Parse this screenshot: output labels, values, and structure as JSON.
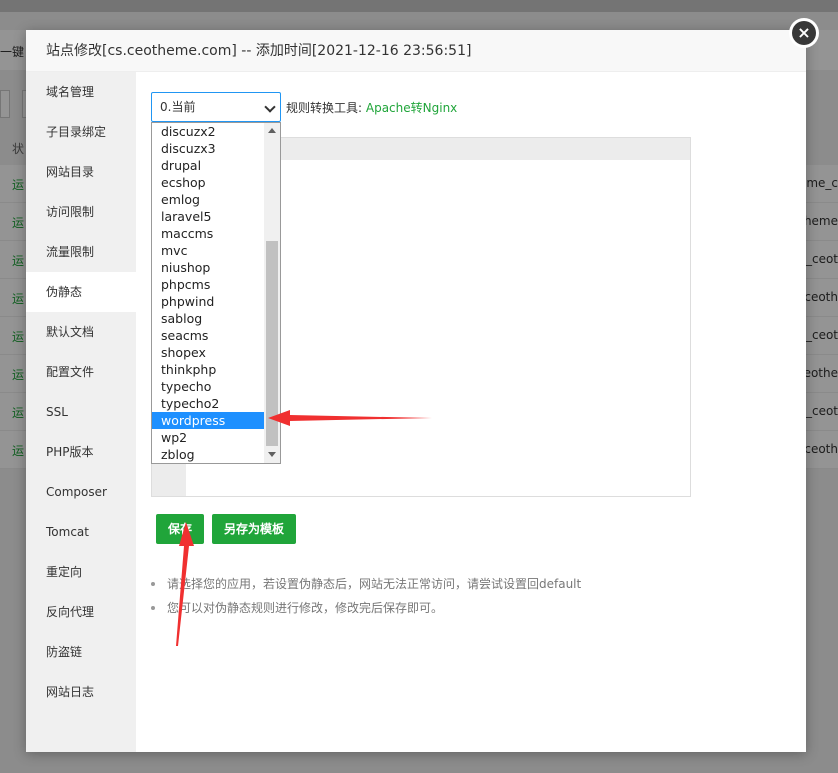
{
  "modal": {
    "title": "站点修改[cs.ceotheme.com] -- 添加时间[2021-12-16 23:56:51]",
    "close_icon": "×"
  },
  "background": {
    "bar_label": "一键",
    "header_left": "状",
    "rows_left": [
      "运",
      "运",
      "运",
      "运",
      "运",
      "运",
      "运",
      "运"
    ],
    "rows_right": [
      "eme_c",
      "theme",
      "_ceot",
      "ceoth",
      "_ceot",
      "eothe",
      "_ceot",
      "ceoth"
    ]
  },
  "sidebar": {
    "items": [
      {
        "label": "域名管理"
      },
      {
        "label": "子目录绑定"
      },
      {
        "label": "网站目录"
      },
      {
        "label": "访问限制"
      },
      {
        "label": "流量限制"
      },
      {
        "label": "伪静态",
        "active": true
      },
      {
        "label": "默认文档"
      },
      {
        "label": "配置文件"
      },
      {
        "label": "SSL"
      },
      {
        "label": "PHP版本"
      },
      {
        "label": "Composer"
      },
      {
        "label": "Tomcat"
      },
      {
        "label": "重定向"
      },
      {
        "label": "反向代理"
      },
      {
        "label": "防盗链"
      },
      {
        "label": "网站日志"
      }
    ]
  },
  "rewrite": {
    "select_value": "0.当前",
    "tool_label": "规则转换工具:",
    "tool_link": "Apache转Nginx",
    "options": [
      "discuzx2",
      "discuzx3",
      "drupal",
      "ecshop",
      "emlog",
      "laravel5",
      "maccms",
      "mvc",
      "niushop",
      "phpcms",
      "phpwind",
      "sablog",
      "seacms",
      "shopex",
      "thinkphp",
      "typecho",
      "typecho2",
      "wordpress",
      "wp2",
      "zblog"
    ],
    "selected_option": "wordpress",
    "save_label": "保存",
    "save_template_label": "另存为模板",
    "tips": [
      "请选择您的应用，若设置伪静态后，网站无法正常访问，请尝试设置回default",
      "您可以对伪静态规则进行修改，修改完后保存即可。"
    ]
  },
  "colors": {
    "accent_green": "#20a53a",
    "selected_blue": "#1e90ff",
    "annotation_red": "#f03030"
  }
}
